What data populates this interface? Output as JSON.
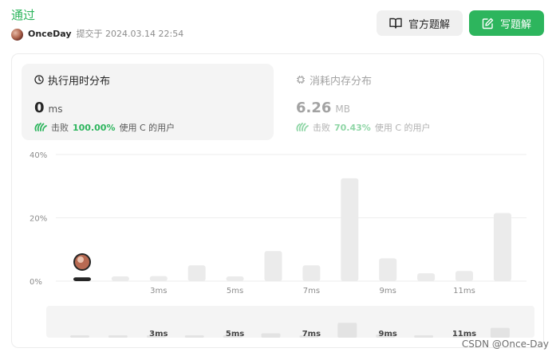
{
  "status": "通过",
  "submission": {
    "author": "OnceDay",
    "submitted_text": "提交于 2024.03.14 22:54"
  },
  "buttons": {
    "official": "官方题解",
    "write": "写题解"
  },
  "runtime": {
    "title": "执行用时分布",
    "value": "0",
    "unit": "ms",
    "beat_prefix": "击败",
    "beat_pct": "100.00%",
    "beat_suffix": "使用 C 的用户"
  },
  "memory": {
    "title": "消耗内存分布",
    "value": "6.26",
    "unit": "MB",
    "beat_prefix": "击败",
    "beat_pct": "70.43%",
    "beat_suffix": "使用 C 的用户"
  },
  "colors": {
    "accent": "#2db55d",
    "bar": "#ebebeb",
    "highlight_bar": "#262626"
  },
  "chart_data": {
    "type": "bar",
    "yticks": [
      "40%",
      "20%",
      "0%"
    ],
    "ylim": [
      0,
      40
    ],
    "xtick_labels": [
      "3ms",
      "5ms",
      "7ms",
      "9ms",
      "11ms"
    ],
    "values": [
      1.2,
      1.5,
      1.6,
      5,
      1.5,
      9.5,
      5,
      32.5,
      7.2,
      2.5,
      3.2,
      21.5
    ],
    "highlight_index": 0,
    "minimap_labels": [
      "3ms",
      "5ms",
      "7ms",
      "9ms",
      "11ms"
    ]
  },
  "watermark": "CSDN @Once-Day"
}
